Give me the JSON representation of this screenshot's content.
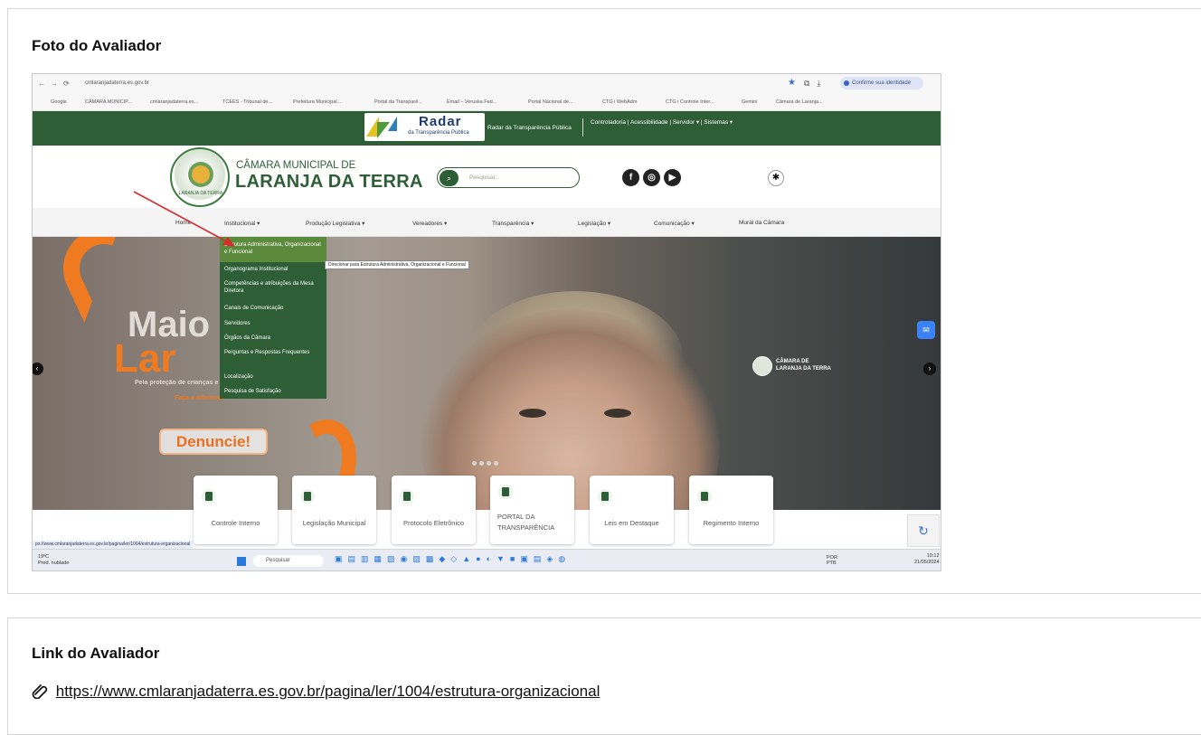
{
  "photo_section": {
    "title": "Foto do Avaliador"
  },
  "link_section": {
    "title": "Link do Avaliador",
    "url": "https://www.cmlaranjadaterra.es.gov.br/pagina/ler/1004/estrutura-organizacional"
  },
  "browser": {
    "url": "cmlaranjadaterra.es.gov.br",
    "identity_button": "Confirme sua identidade",
    "bookmarks": [
      "Google",
      "CÂMARA MUNICIP...",
      "cmlaranjadaterra.es...",
      "TCEES - Tribunal de...",
      "Prefeitura Municipal...",
      "Portal da Transparê...",
      "Email – Veruska Fed...",
      "Portal Nacional de...",
      "CTG i WebAdm",
      "CTG i Controle Inter...",
      "Gemini",
      "Câmara de Laranja..."
    ]
  },
  "site": {
    "radar": {
      "logo_word": "Radar",
      "logo_sub": "da Transparência Pública",
      "text": "Radar da Transparência Pública",
      "menu": "Controladoria  |  Acessibilidade  |  Servidor ▾  |  Sistemas ▾"
    },
    "org_prefix": "CÂMARA MUNICIPAL DE",
    "org_name": "LARANJA DA TERRA",
    "seal_text": "LARANJA DA TERRA",
    "search_placeholder": "Pesquisar...",
    "nav": [
      "Home",
      "Institucional ▾",
      "Produção Legislativa ▾",
      "Vereadores ▾",
      "Transparência ▾",
      "Legislação ▾",
      "Comunicação ▾",
      "Mural da Câmara"
    ],
    "dropdown": [
      "Estrutura Administrativa, Organizacional e Funcional",
      "Organograma Institucional",
      "Competências e atribuições da Mesa Diretora",
      "Canais de Comunicação",
      "Servidores",
      "Órgãos da Câmara",
      "Perguntas e Respostas Frequentes",
      "Localização",
      "Pesquisa de Satisfação"
    ],
    "tooltip": "Direcionar para Estrutura Administrativa, Organizacional e Funcional",
    "hero": {
      "line1": "Maio",
      "line2": "Lar",
      "small1": "Pela proteção de crianças e",
      "small2": "Faça a diferença",
      "button": "Denuncie!",
      "brand": "CÂMARA DE\nLARANJA DA TERRA"
    },
    "tiles": [
      "Controle Interno",
      "Legislação Municipal",
      "Protocolo Eletrônico",
      "PORTAL DA TRANSPARÊNCIA",
      "Leis em Destaque",
      "Regimento Interno"
    ],
    "status_url": "ps://www.cmlaranjadaterra.es.gov.br/pagina/ler/1004/estrutura-organizacional"
  },
  "taskbar": {
    "temp": "19ºC",
    "weather": "Pred. nublado",
    "search": "Pesquisar",
    "lang": "POR\nPTB",
    "time": "10:12",
    "date": "21/05/2024"
  }
}
